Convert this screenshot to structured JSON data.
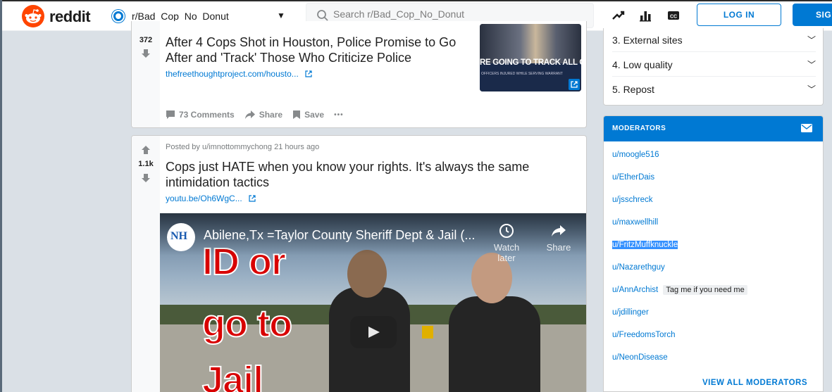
{
  "header": {
    "logo_text": "reddit",
    "subreddit": "r/Bad_Cop_No_Donut",
    "search_placeholder": "Search r/Bad_Cop_No_Donut",
    "login_label": "LOG IN",
    "signup_label": "SIG"
  },
  "posts": [
    {
      "score": "372",
      "title": "After 4 Cops Shot in Houston, Police Promise to Go After and 'Track' Those Who Criticize Police",
      "link": "thefreethoughtproject.com/housto...",
      "thumbnail_caption": "RE GOING TO TRACK ALL OF",
      "thumbnail_subcaption": "OFFICERS INJURED WHILE SERVING WARRANT",
      "comments": "73 Comments",
      "share": "Share",
      "save": "Save",
      "more": "•••"
    },
    {
      "score": "1.1k",
      "meta": "Posted by u/imnottommychong 21 hours ago",
      "title": "Cops just HATE when you know your rights. It's always the same intimidation tactics",
      "link": "youtu.be/Oh6WgC...",
      "video": {
        "channel_logo": "NH",
        "title": "Abilene,Tx =Taylor County Sheriff Dept & Jail (...",
        "watch_later": "Watch later",
        "share": "Share",
        "overlay_lines": [
          "ID or",
          "go to",
          "Jail"
        ]
      }
    }
  ],
  "sidebar": {
    "rules": [
      "3. External sites",
      "4. Low quality",
      "5. Repost"
    ],
    "moderators_title": "MODERATORS",
    "moderators": [
      {
        "name": "u/moogle516"
      },
      {
        "name": "u/EtherDais"
      },
      {
        "name": "u/jsschreck"
      },
      {
        "name": "u/maxwellhill"
      },
      {
        "name": "u/FritzMuffknuckle"
      },
      {
        "name": "u/Nazarethguy"
      },
      {
        "name": "u/AnnArchist",
        "flair": "Tag me if you need me"
      },
      {
        "name": "u/jdillinger"
      },
      {
        "name": "u/FreedomsTorch"
      },
      {
        "name": "u/NeonDisease"
      }
    ],
    "view_all": "VIEW ALL MODERATORS"
  },
  "colors": {
    "accent": "#0079d3",
    "brand": "#ff4500",
    "overlay_text": "#d80000"
  }
}
